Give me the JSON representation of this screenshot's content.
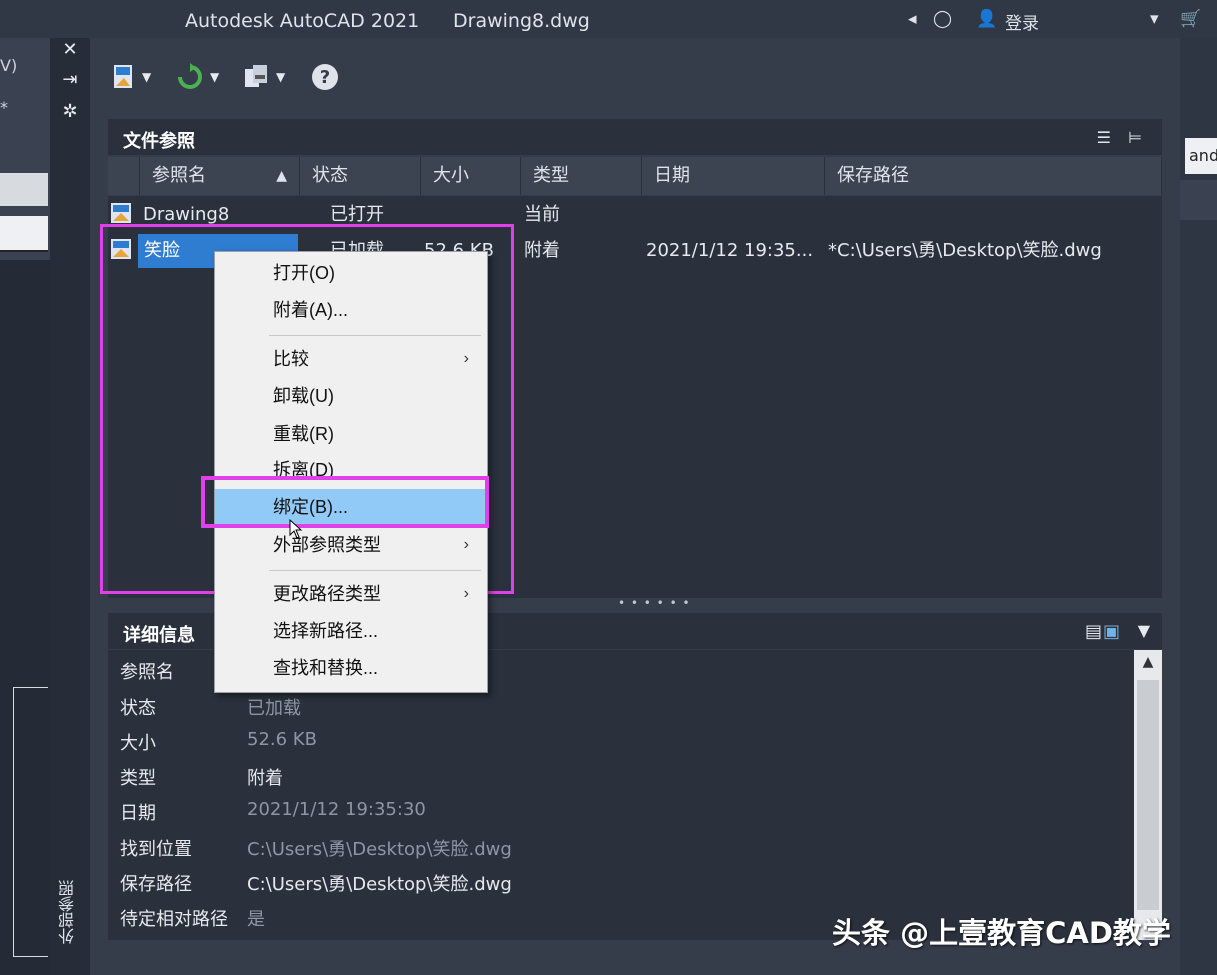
{
  "titlebar": {
    "app_title": "Autodesk AutoCAD 2021",
    "doc_title": "Drawing8.dwg",
    "login_label": "登录"
  },
  "background": {
    "left_fragment_1": "V)",
    "left_fragment_2": "*",
    "right_fragment": "and"
  },
  "palette": {
    "vertical_title": "外部参照",
    "file_refs": {
      "title": "文件参照",
      "columns": [
        "参照名",
        "状态",
        "大小",
        "类型",
        "日期",
        "保存路径"
      ],
      "rows": [
        {
          "name": "Drawing8",
          "status": "已打开",
          "size": "",
          "type": "当前",
          "date": "",
          "path": ""
        },
        {
          "name": "笑脸",
          "status": "已加载",
          "size": "52.6 KB",
          "type": "附着",
          "date": "2021/1/12 19:35...",
          "path": "*C:\\Users\\勇\\Desktop\\笑脸.dwg"
        }
      ]
    },
    "details": {
      "title": "详细信息",
      "fields": [
        {
          "label": "参照名",
          "value": ""
        },
        {
          "label": "状态",
          "value": "已加载"
        },
        {
          "label": "大小",
          "value": "52.6 KB"
        },
        {
          "label": "类型",
          "value": "附着"
        },
        {
          "label": "日期",
          "value": "2021/1/12 19:35:30"
        },
        {
          "label": "找到位置",
          "value": "C:\\Users\\勇\\Desktop\\笑脸.dwg"
        },
        {
          "label": "保存路径",
          "value": "C:\\Users\\勇\\Desktop\\笑脸.dwg"
        },
        {
          "label": "待定相对路径",
          "value": "是"
        }
      ]
    }
  },
  "context_menu": {
    "items": [
      {
        "label": "打开(O)"
      },
      {
        "label": "附着(A)..."
      },
      {
        "label": "比较"
      },
      {
        "label": "卸载(U)"
      },
      {
        "label": "重载(R)"
      },
      {
        "label": "拆离(D)"
      },
      {
        "label": "绑定(B)..."
      },
      {
        "label": "外部参照类型"
      },
      {
        "label": "更改路径类型"
      },
      {
        "label": "选择新路径..."
      },
      {
        "label": "查找和替换..."
      }
    ],
    "arrow_glyph": "›",
    "highlighted": "绑定(B)..."
  },
  "watermark": "头条 @上壹教育CAD教学",
  "colors": {
    "accent": "#2f7dd1",
    "annotation": "#e040e8",
    "menu_hover": "#91c9f7"
  }
}
